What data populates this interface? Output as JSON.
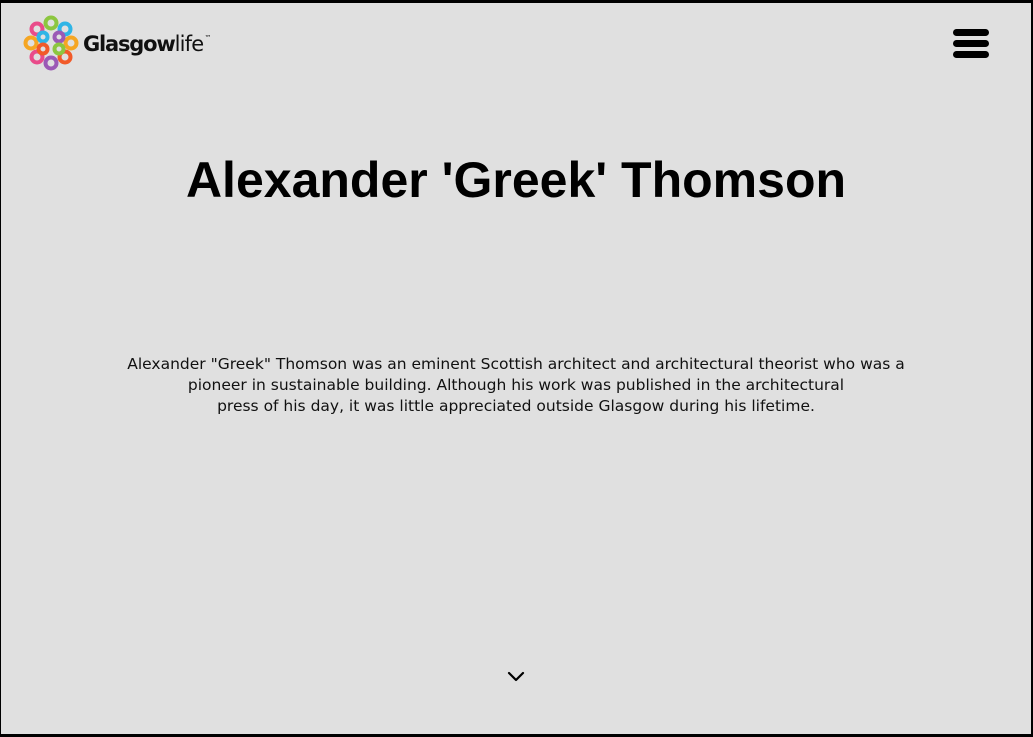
{
  "brand": {
    "name_bold": "Glasgow",
    "name_light": "life",
    "trademark": "™",
    "logo_icon": "glasgow-life-flower-logo",
    "logo_colors": [
      "#e94b8a",
      "#f5a623",
      "#2fb5e6",
      "#8cc63f",
      "#9b59b6",
      "#f15a29"
    ]
  },
  "header": {
    "menu_icon": "hamburger-menu-icon"
  },
  "main": {
    "title": "Alexander 'Greek' Thomson",
    "intro_lines": [
      "Alexander \"Greek\" Thomson was an eminent Scottish architect and architectural theorist who was a",
      "pioneer in sustainable building. Although his work was published in the architectural",
      "press of his day, it was little appreciated outside Glasgow during his lifetime."
    ],
    "scroll_icon": "chevron-down-icon"
  },
  "colors": {
    "background": "#e0e0e0",
    "text": "#000000"
  }
}
